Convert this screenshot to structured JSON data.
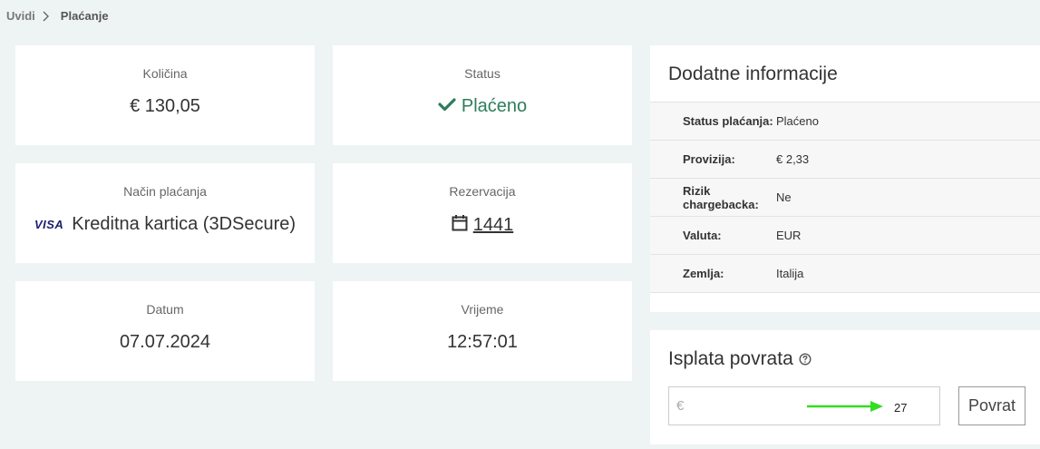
{
  "breadcrumb": {
    "parent": "Uvidi",
    "current": "Plaćanje"
  },
  "cards": {
    "amount": {
      "label": "Količina",
      "value": "€ 130,05"
    },
    "status": {
      "label": "Status",
      "value": "Plaćeno",
      "color": "#2e7d5b"
    },
    "payment_method": {
      "label": "Način plaćanja",
      "brand": "VISA",
      "value": "Kreditna kartica (3DSecure)"
    },
    "reservation": {
      "label": "Rezervacija",
      "value": "1441"
    },
    "date": {
      "label": "Datum",
      "value": "07.07.2024"
    },
    "time": {
      "label": "Vrijeme",
      "value": "12:57:01"
    }
  },
  "additional_info": {
    "title": "Dodatne informacije",
    "rows": [
      {
        "key": "Status plaćanja:",
        "value": "Plaćeno"
      },
      {
        "key": "Provizija:",
        "value": "€ 2,33"
      },
      {
        "key": "Rizik chargebacka:",
        "value": "Ne"
      },
      {
        "key": "Valuta:",
        "value": "EUR"
      },
      {
        "key": "Zemlja:",
        "value": "Italija"
      }
    ]
  },
  "refund": {
    "title": "Isplata povrata",
    "currency_symbol": "€",
    "amount": "27",
    "button_label": "Povrat",
    "annotation_color": "#33dd22"
  },
  "icons": [
    "chevron-right-icon",
    "check-icon",
    "visa-logo",
    "calendar-icon",
    "help-circle-icon",
    "arrow-right-icon"
  ]
}
